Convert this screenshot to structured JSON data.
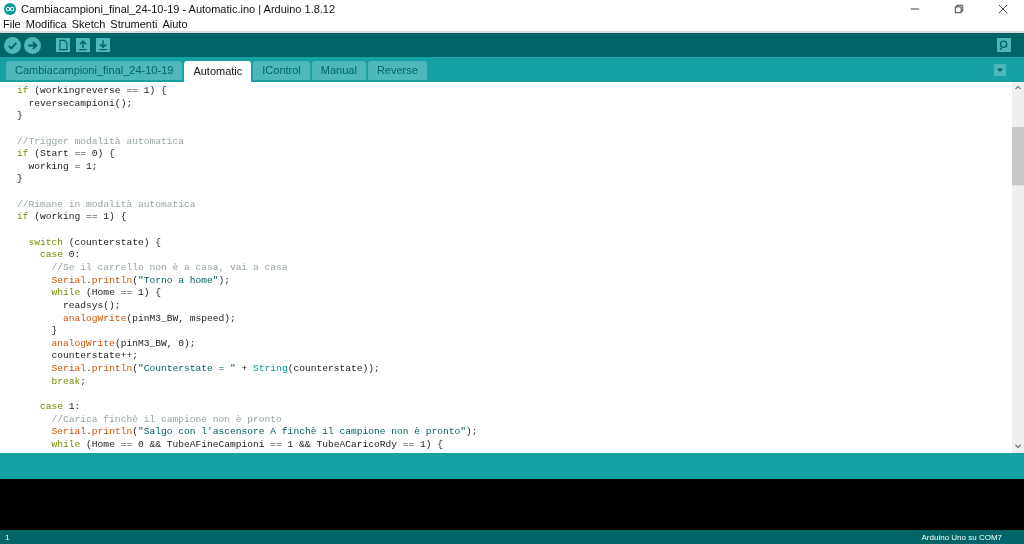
{
  "window": {
    "title": "Cambiacampioni_final_24-10-19 - Automatic.ino | Arduino 1.8.12"
  },
  "menu": [
    "File",
    "Modifica",
    "Sketch",
    "Strumenti",
    "Aiuto"
  ],
  "tabs": [
    {
      "label": "Cambiacampioni_final_24-10-19",
      "selected": false
    },
    {
      "label": "Automatic",
      "selected": true
    },
    {
      "label": "IControl",
      "selected": false
    },
    {
      "label": "Manual",
      "selected": false
    },
    {
      "label": "Reverse",
      "selected": false
    }
  ],
  "code_lines": [
    {
      "kind": "code",
      "tokens": [
        {
          "kind": "keyword",
          "text": "if"
        },
        {
          "kind": "plain",
          "text": " (workingreverse == 1) {"
        }
      ]
    },
    {
      "kind": "code",
      "tokens": [
        {
          "kind": "plain",
          "text": "  reversecampioni();"
        }
      ]
    },
    {
      "kind": "code",
      "tokens": [
        {
          "kind": "plain",
          "text": "}"
        }
      ]
    },
    {
      "kind": "blank"
    },
    {
      "kind": "code",
      "tokens": [
        {
          "kind": "comment",
          "text": "//Trigger modalità automatica"
        }
      ]
    },
    {
      "kind": "code",
      "tokens": [
        {
          "kind": "keyword",
          "text": "if"
        },
        {
          "kind": "plain",
          "text": " (Start == 0) {"
        }
      ]
    },
    {
      "kind": "code",
      "tokens": [
        {
          "kind": "plain",
          "text": "  working = 1;"
        }
      ]
    },
    {
      "kind": "code",
      "tokens": [
        {
          "kind": "plain",
          "text": "}"
        }
      ]
    },
    {
      "kind": "blank"
    },
    {
      "kind": "code",
      "tokens": [
        {
          "kind": "comment",
          "text": "//Rimane in modalità automatica"
        }
      ]
    },
    {
      "kind": "code",
      "tokens": [
        {
          "kind": "keyword",
          "text": "if"
        },
        {
          "kind": "plain",
          "text": " (working == 1) {"
        }
      ]
    },
    {
      "kind": "blank"
    },
    {
      "kind": "code",
      "tokens": [
        {
          "kind": "keyword",
          "text": "  switch"
        },
        {
          "kind": "plain",
          "text": " (counterstate) {"
        }
      ]
    },
    {
      "kind": "code",
      "tokens": [
        {
          "kind": "keyword",
          "text": "    case"
        },
        {
          "kind": "plain",
          "text": " 0:"
        }
      ]
    },
    {
      "kind": "code",
      "tokens": [
        {
          "kind": "comment",
          "text": "      //Se il carrello non è a casa, vai a casa"
        }
      ]
    },
    {
      "kind": "code",
      "tokens": [
        {
          "kind": "function",
          "text": "      Serial"
        },
        {
          "kind": "plain",
          "text": "."
        },
        {
          "kind": "function",
          "text": "println"
        },
        {
          "kind": "plain",
          "text": "("
        },
        {
          "kind": "string",
          "text": "\"Torno a home\""
        },
        {
          "kind": "plain",
          "text": ");"
        }
      ]
    },
    {
      "kind": "code",
      "tokens": [
        {
          "kind": "keyword",
          "text": "      while"
        },
        {
          "kind": "plain",
          "text": " (Home == 1) {"
        }
      ]
    },
    {
      "kind": "code",
      "tokens": [
        {
          "kind": "plain",
          "text": "        readsys();"
        }
      ]
    },
    {
      "kind": "code",
      "tokens": [
        {
          "kind": "function",
          "text": "        analogWrite"
        },
        {
          "kind": "plain",
          "text": "(pinM3_BW, mspeed);"
        }
      ]
    },
    {
      "kind": "code",
      "tokens": [
        {
          "kind": "plain",
          "text": "      }"
        }
      ]
    },
    {
      "kind": "code",
      "tokens": [
        {
          "kind": "function",
          "text": "      analogWrite"
        },
        {
          "kind": "plain",
          "text": "(pinM3_BW, 0);"
        }
      ]
    },
    {
      "kind": "code",
      "tokens": [
        {
          "kind": "plain",
          "text": "      counterstate++;"
        }
      ]
    },
    {
      "kind": "code",
      "tokens": [
        {
          "kind": "function",
          "text": "      Serial"
        },
        {
          "kind": "plain",
          "text": "."
        },
        {
          "kind": "function",
          "text": "println"
        },
        {
          "kind": "plain",
          "text": "("
        },
        {
          "kind": "string",
          "text": "\"Counterstate = \""
        },
        {
          "kind": "plain",
          "text": " + "
        },
        {
          "kind": "type",
          "text": "String"
        },
        {
          "kind": "plain",
          "text": "(counterstate));"
        }
      ]
    },
    {
      "kind": "code",
      "tokens": [
        {
          "kind": "keyword",
          "text": "      break"
        },
        {
          "kind": "plain",
          "text": ";"
        }
      ]
    },
    {
      "kind": "blank"
    },
    {
      "kind": "code",
      "tokens": [
        {
          "kind": "keyword",
          "text": "    case"
        },
        {
          "kind": "plain",
          "text": " 1:"
        }
      ]
    },
    {
      "kind": "code",
      "tokens": [
        {
          "kind": "comment",
          "text": "      //Carica finchè il campione non è pronto"
        }
      ]
    },
    {
      "kind": "code",
      "tokens": [
        {
          "kind": "function",
          "text": "      Serial"
        },
        {
          "kind": "plain",
          "text": "."
        },
        {
          "kind": "function",
          "text": "println"
        },
        {
          "kind": "plain",
          "text": "("
        },
        {
          "kind": "string",
          "text": "\"Salgo con l'ascensore A finchè il campione non è pronto\""
        },
        {
          "kind": "plain",
          "text": ");"
        }
      ]
    },
    {
      "kind": "code",
      "tokens": [
        {
          "kind": "keyword",
          "text": "      while"
        },
        {
          "kind": "plain",
          "text": " (Home == 0 && TubeAFineCampioni == 1 && TubeACaricoRdy == 1) {"
        }
      ]
    }
  ],
  "status_bar": {
    "line": "1",
    "board": "Arduino Uno su COM7"
  }
}
